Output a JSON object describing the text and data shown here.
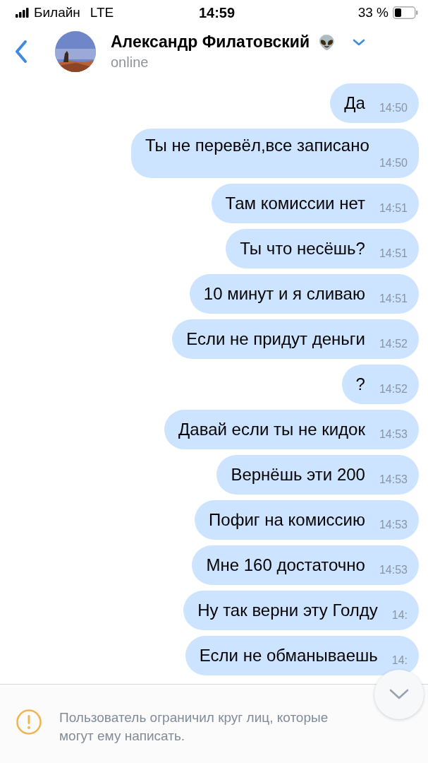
{
  "status_bar": {
    "carrier": "Билайн",
    "network": "LTE",
    "time": "14:59",
    "battery": "33 %"
  },
  "header": {
    "name": "Александр Филатовский",
    "emoji": "👽",
    "status": "online"
  },
  "messages": [
    {
      "text": "Да",
      "time": "14:50"
    },
    {
      "text": "Ты не перевёл,все записано",
      "time": "14:50"
    },
    {
      "text": "Там комиссии нет",
      "time": "14:51"
    },
    {
      "text": "Ты что несёшь?",
      "time": "14:51"
    },
    {
      "text": "10 минут и я сливаю",
      "time": "14:51"
    },
    {
      "text": "Если не придут деньги",
      "time": "14:52"
    },
    {
      "text": "?",
      "time": "14:52"
    },
    {
      "text": "Давай если ты не кидок",
      "time": "14:53"
    },
    {
      "text": "Вернёшь эти 200",
      "time": "14:53"
    },
    {
      "text": "Пофиг на комиссию",
      "time": "14:53"
    },
    {
      "text": "Мне 160 достаточно",
      "time": "14:53"
    },
    {
      "text": "Ну так верни эту Голду",
      "time": "14:"
    },
    {
      "text": "Если не обманываешь",
      "time": "14:"
    }
  ],
  "notice": "Пользователь ограничил круг лиц, которые могут ему написать."
}
